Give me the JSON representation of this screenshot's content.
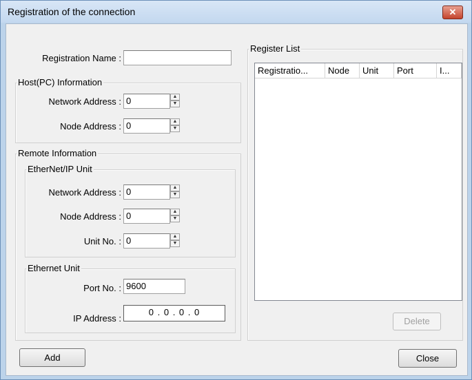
{
  "window": {
    "title": "Registration of the connection",
    "close_glyph": "✕"
  },
  "registration": {
    "label": "Registration Name :",
    "value": ""
  },
  "host": {
    "group_label": "Host(PC) Information",
    "network_address_label": "Network Address :",
    "network_address_value": "0",
    "node_address_label": "Node Address :",
    "node_address_value": "0"
  },
  "remote": {
    "group_label": "Remote Information",
    "ethernet_ip": {
      "group_label": "EtherNet/IP Unit",
      "network_address_label": "Network Address :",
      "network_address_value": "0",
      "node_address_label": "Node Address :",
      "node_address_value": "0",
      "unit_no_label": "Unit No. :",
      "unit_no_value": "0"
    },
    "ethernet_unit": {
      "group_label": "Ethernet Unit",
      "port_label": "Port No. :",
      "port_value": "9600",
      "ip_label": "IP Address :",
      "ip_value": "0 . 0 . 0 . 0"
    }
  },
  "register_list": {
    "group_label": "Register List",
    "columns": [
      "Registratio...",
      "Node",
      "Unit",
      "Port",
      "I..."
    ],
    "delete_label": "Delete"
  },
  "buttons": {
    "add": "Add",
    "close": "Close"
  }
}
